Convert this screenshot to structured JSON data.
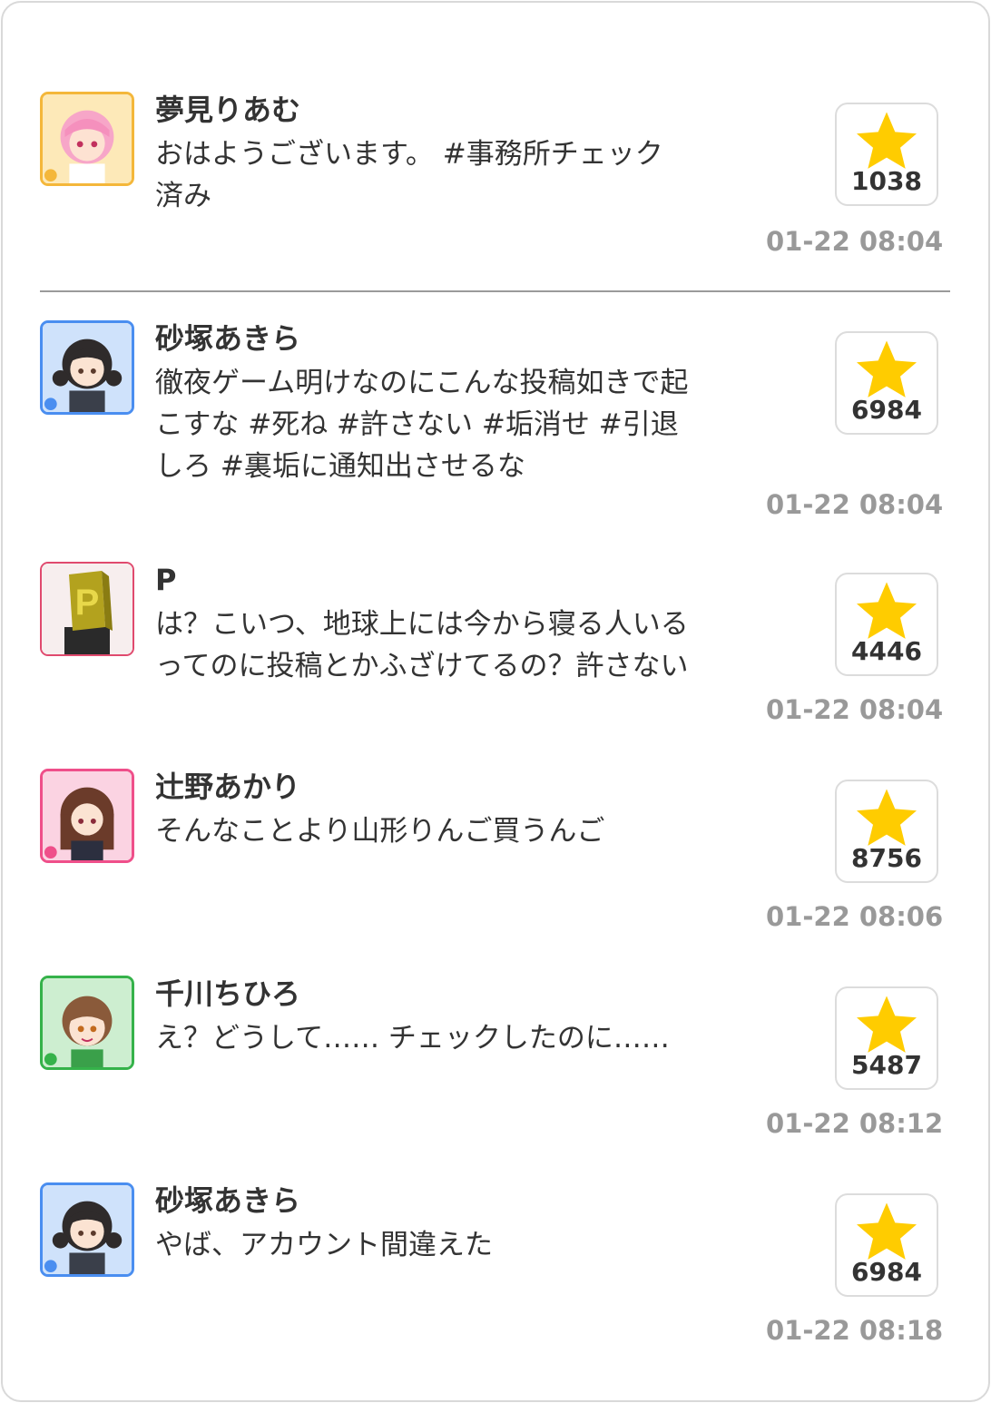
{
  "colors": {
    "star": "#ffcc00",
    "timestamp": "#999999",
    "divider": "#9a9a9a"
  },
  "posts": [
    {
      "name": "夢見りあむ",
      "message": "おはようございます。 #事務所チェック済み",
      "likes": "1038",
      "time": "01-22 08:04",
      "avatar_icon": "pink-hair-girl-avatar-icon",
      "frame_color": "#f4b73a"
    },
    {
      "name": "砂塚あきら",
      "message": "徹夜ゲーム明けなのにこんな投稿如きで起こすな #死ね #許さない #垢消せ #引退しろ #裏垢に通知出させるな",
      "likes": "6984",
      "time": "01-22 08:04",
      "avatar_icon": "dark-hair-girl-avatar-icon",
      "frame_color": "#4a8ef0"
    },
    {
      "name": "P",
      "message": "は？こいつ、地球上には今から寝る人いるってのに投稿とかふざけてるの？許さない",
      "likes": "4446",
      "time": "01-22 08:04",
      "avatar_icon": "producer-p-head-avatar-icon",
      "frame_color": "#e04a6e"
    },
    {
      "name": "辻野あかり",
      "message": "そんなことより山形りんご買うんご",
      "likes": "8756",
      "time": "01-22 08:06",
      "avatar_icon": "brown-hair-girl-avatar-icon",
      "frame_color": "#ef4f8a"
    },
    {
      "name": "千川ちひろ",
      "message": "え？どうして…… チェックしたのに……",
      "likes": "5487",
      "time": "01-22 08:12",
      "avatar_icon": "assistant-girl-avatar-icon",
      "frame_color": "#35b24a"
    },
    {
      "name": "砂塚あきら",
      "message": "やば、アカウント間違えた",
      "likes": "6984",
      "time": "01-22 08:18",
      "avatar_icon": "dark-hair-girl-avatar-icon",
      "frame_color": "#4a8ef0"
    }
  ]
}
